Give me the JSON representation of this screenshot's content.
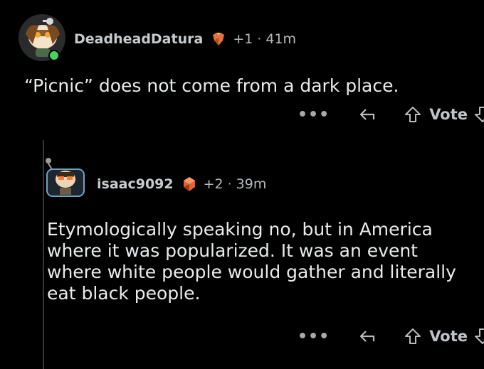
{
  "comment": {
    "username": "DeadheadDatura",
    "award_icon": "award-crystal-icon",
    "score": "+1",
    "separator": "·",
    "time": "41m",
    "body": "“Picnic” does not come from a dark place.",
    "actions": {
      "more": "•••",
      "vote_label": "Vote"
    }
  },
  "reply": {
    "username": "isaac9092",
    "award_icon": "award-crystal-icon",
    "score": "+2",
    "separator": "·",
    "time": "39m",
    "body": "Etymologically speaking no, but in America where it was popularized. It was an event where white people would gather and literally eat black people.",
    "actions": {
      "more": "•••",
      "vote_label": "Vote"
    }
  },
  "colors": {
    "background": "#000000",
    "text": "#e8eaec",
    "meta": "#b6b9bc",
    "online_dot": "#46d160",
    "thread_line": "#343536"
  }
}
